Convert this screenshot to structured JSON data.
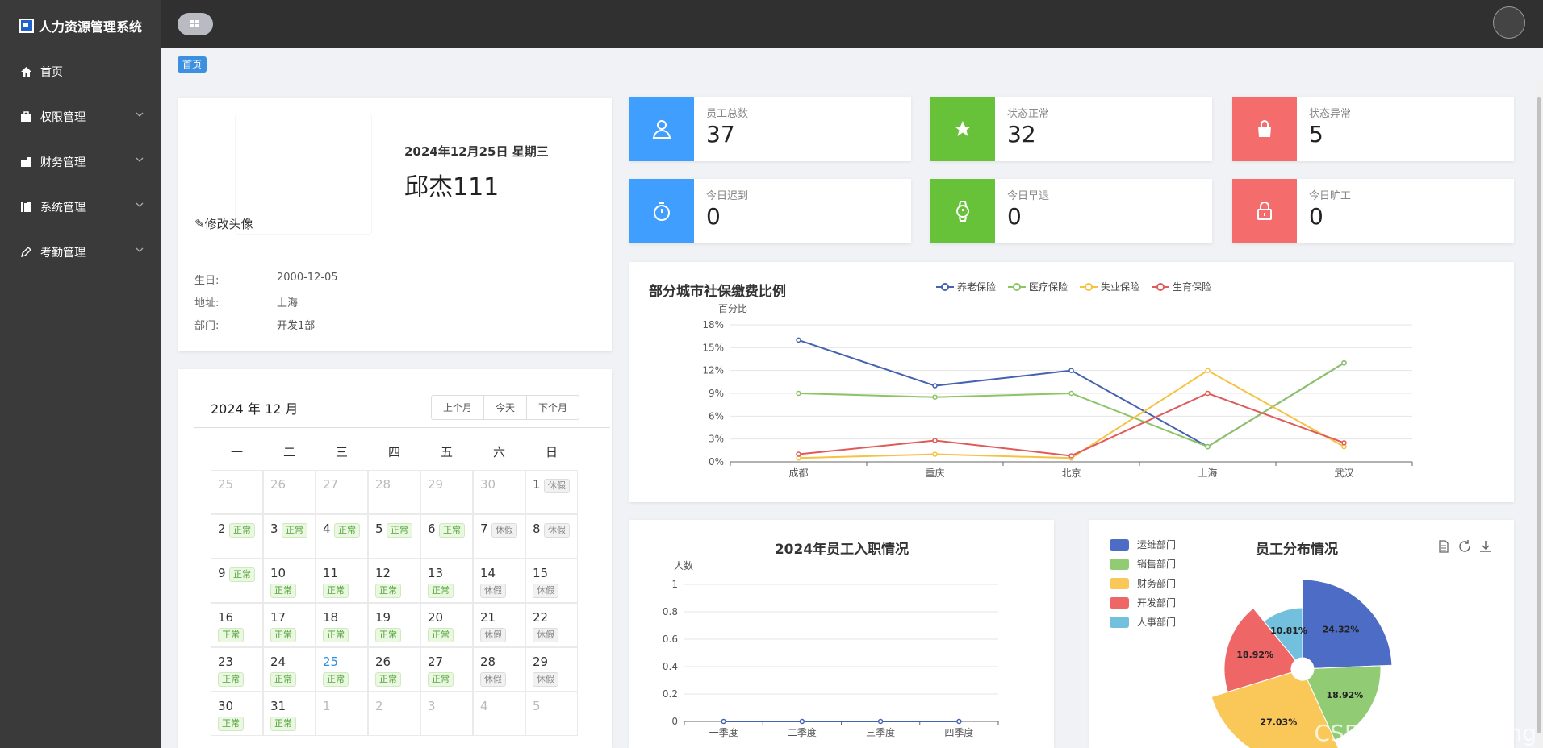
{
  "app": {
    "title": "人力资源管理系统"
  },
  "sidebar": {
    "items": [
      {
        "label": "首页",
        "icon": "home-icon"
      },
      {
        "label": "权限管理",
        "icon": "briefcase-icon"
      },
      {
        "label": "财务管理",
        "icon": "wallet-icon"
      },
      {
        "label": "系统管理",
        "icon": "books-icon"
      },
      {
        "label": "考勤管理",
        "icon": "pencil-icon"
      }
    ]
  },
  "breadcrumb": {
    "label": "首页"
  },
  "profile": {
    "date": "2024年12月25日 星期三",
    "name": "邱杰111",
    "edit_avatar": "修改头像",
    "birthday_label": "生日:",
    "birthday": "2000-12-05",
    "address_label": "地址:",
    "address": "上海",
    "dept_label": "部门:",
    "dept": "开发1部"
  },
  "stats": [
    {
      "label": "员工总数",
      "value": "37",
      "color": "#409eff",
      "icon": "user-icon"
    },
    {
      "label": "状态正常",
      "value": "32",
      "color": "#67c23a",
      "icon": "star-icon"
    },
    {
      "label": "状态异常",
      "value": "5",
      "color": "#f56c6c",
      "icon": "bag-icon"
    },
    {
      "label": "今日迟到",
      "value": "0",
      "color": "#409eff",
      "icon": "stopwatch-icon"
    },
    {
      "label": "今日早退",
      "value": "0",
      "color": "#67c23a",
      "icon": "watch-icon"
    },
    {
      "label": "今日旷工",
      "value": "0",
      "color": "#f56c6c",
      "icon": "lock-icon"
    }
  ],
  "calendar": {
    "title": "2024 年 12 月",
    "prev": "上个月",
    "today": "今天",
    "next": "下个月",
    "weekdays": [
      "一",
      "二",
      "三",
      "四",
      "五",
      "六",
      "日"
    ],
    "today_date": 25,
    "weeks": [
      [
        {
          "d": "25",
          "o": true
        },
        {
          "d": "26",
          "o": true
        },
        {
          "d": "27",
          "o": true
        },
        {
          "d": "28",
          "o": true
        },
        {
          "d": "29",
          "o": true
        },
        {
          "d": "30",
          "o": true
        },
        {
          "d": "1",
          "s": "休假"
        }
      ],
      [
        {
          "d": "2",
          "s": "正常"
        },
        {
          "d": "3",
          "s": "正常"
        },
        {
          "d": "4",
          "s": "正常"
        },
        {
          "d": "5",
          "s": "正常"
        },
        {
          "d": "6",
          "s": "正常"
        },
        {
          "d": "7",
          "s": "休假"
        },
        {
          "d": "8",
          "s": "休假"
        }
      ],
      [
        {
          "d": "9",
          "s": "正常"
        },
        {
          "d": "10",
          "s": "正常"
        },
        {
          "d": "11",
          "s": "正常"
        },
        {
          "d": "12",
          "s": "正常"
        },
        {
          "d": "13",
          "s": "正常"
        },
        {
          "d": "14",
          "s": "休假"
        },
        {
          "d": "15",
          "s": "休假"
        }
      ],
      [
        {
          "d": "16",
          "s": "正常"
        },
        {
          "d": "17",
          "s": "正常"
        },
        {
          "d": "18",
          "s": "正常"
        },
        {
          "d": "19",
          "s": "正常"
        },
        {
          "d": "20",
          "s": "正常"
        },
        {
          "d": "21",
          "s": "休假"
        },
        {
          "d": "22",
          "s": "休假"
        }
      ],
      [
        {
          "d": "23",
          "s": "正常"
        },
        {
          "d": "24",
          "s": "正常"
        },
        {
          "d": "25",
          "s": "正常"
        },
        {
          "d": "26",
          "s": "正常"
        },
        {
          "d": "27",
          "s": "正常"
        },
        {
          "d": "28",
          "s": "休假"
        },
        {
          "d": "29",
          "s": "休假"
        }
      ],
      [
        {
          "d": "30",
          "s": "正常"
        },
        {
          "d": "31",
          "s": "正常"
        },
        {
          "d": "1",
          "o": true
        },
        {
          "d": "2",
          "o": true
        },
        {
          "d": "3",
          "o": true
        },
        {
          "d": "4",
          "o": true
        },
        {
          "d": "5",
          "o": true
        }
      ]
    ]
  },
  "chart_data": [
    {
      "type": "line",
      "title": "部分城市社保缴费比例",
      "ylabel": "百分比",
      "categories": [
        "成都",
        "重庆",
        "北京",
        "上海",
        "武汉"
      ],
      "yticks": [
        "0%",
        "3%",
        "6%",
        "9%",
        "12%",
        "15%",
        "18%"
      ],
      "ylim": [
        0,
        18
      ],
      "legend": "top",
      "series": [
        {
          "name": "养老保险",
          "color": "#4462b0",
          "values": [
            16,
            10,
            12,
            2,
            13
          ]
        },
        {
          "name": "医疗保险",
          "color": "#8cc466",
          "values": [
            9,
            8.5,
            9,
            2,
            13
          ]
        },
        {
          "name": "失业保险",
          "color": "#f5c242",
          "values": [
            0.5,
            1,
            0.5,
            12,
            2
          ]
        },
        {
          "name": "生育保险",
          "color": "#e05a5a",
          "values": [
            1,
            2.8,
            0.8,
            9,
            2.5
          ]
        }
      ]
    },
    {
      "type": "line",
      "title": "2024年员工入职情况",
      "ylabel": "人数",
      "categories": [
        "一季度",
        "二季度",
        "三季度",
        "四季度"
      ],
      "yticks": [
        "0",
        "0.2",
        "0.4",
        "0.6",
        "0.8",
        "1"
      ],
      "ylim": [
        0,
        1
      ],
      "series": [
        {
          "color": "#4462b0",
          "values": [
            0,
            0,
            0,
            0
          ]
        }
      ]
    },
    {
      "type": "pie",
      "title": "员工分布情况",
      "legend": "top-left",
      "categories": [
        "运维部门",
        "销售部门",
        "财务部门",
        "开发部门",
        "人事部门"
      ],
      "colors": [
        "#4d6cc6",
        "#91cb74",
        "#fac858",
        "#ee6666",
        "#73c0de"
      ],
      "values": [
        24.32,
        18.92,
        27.03,
        18.92,
        10.81
      ],
      "labels": [
        "24.32%",
        "18.92%",
        "27.03%",
        "18.92%",
        "10.81%"
      ]
    }
  ],
  "watermark": "CSDN @xssssliliang"
}
